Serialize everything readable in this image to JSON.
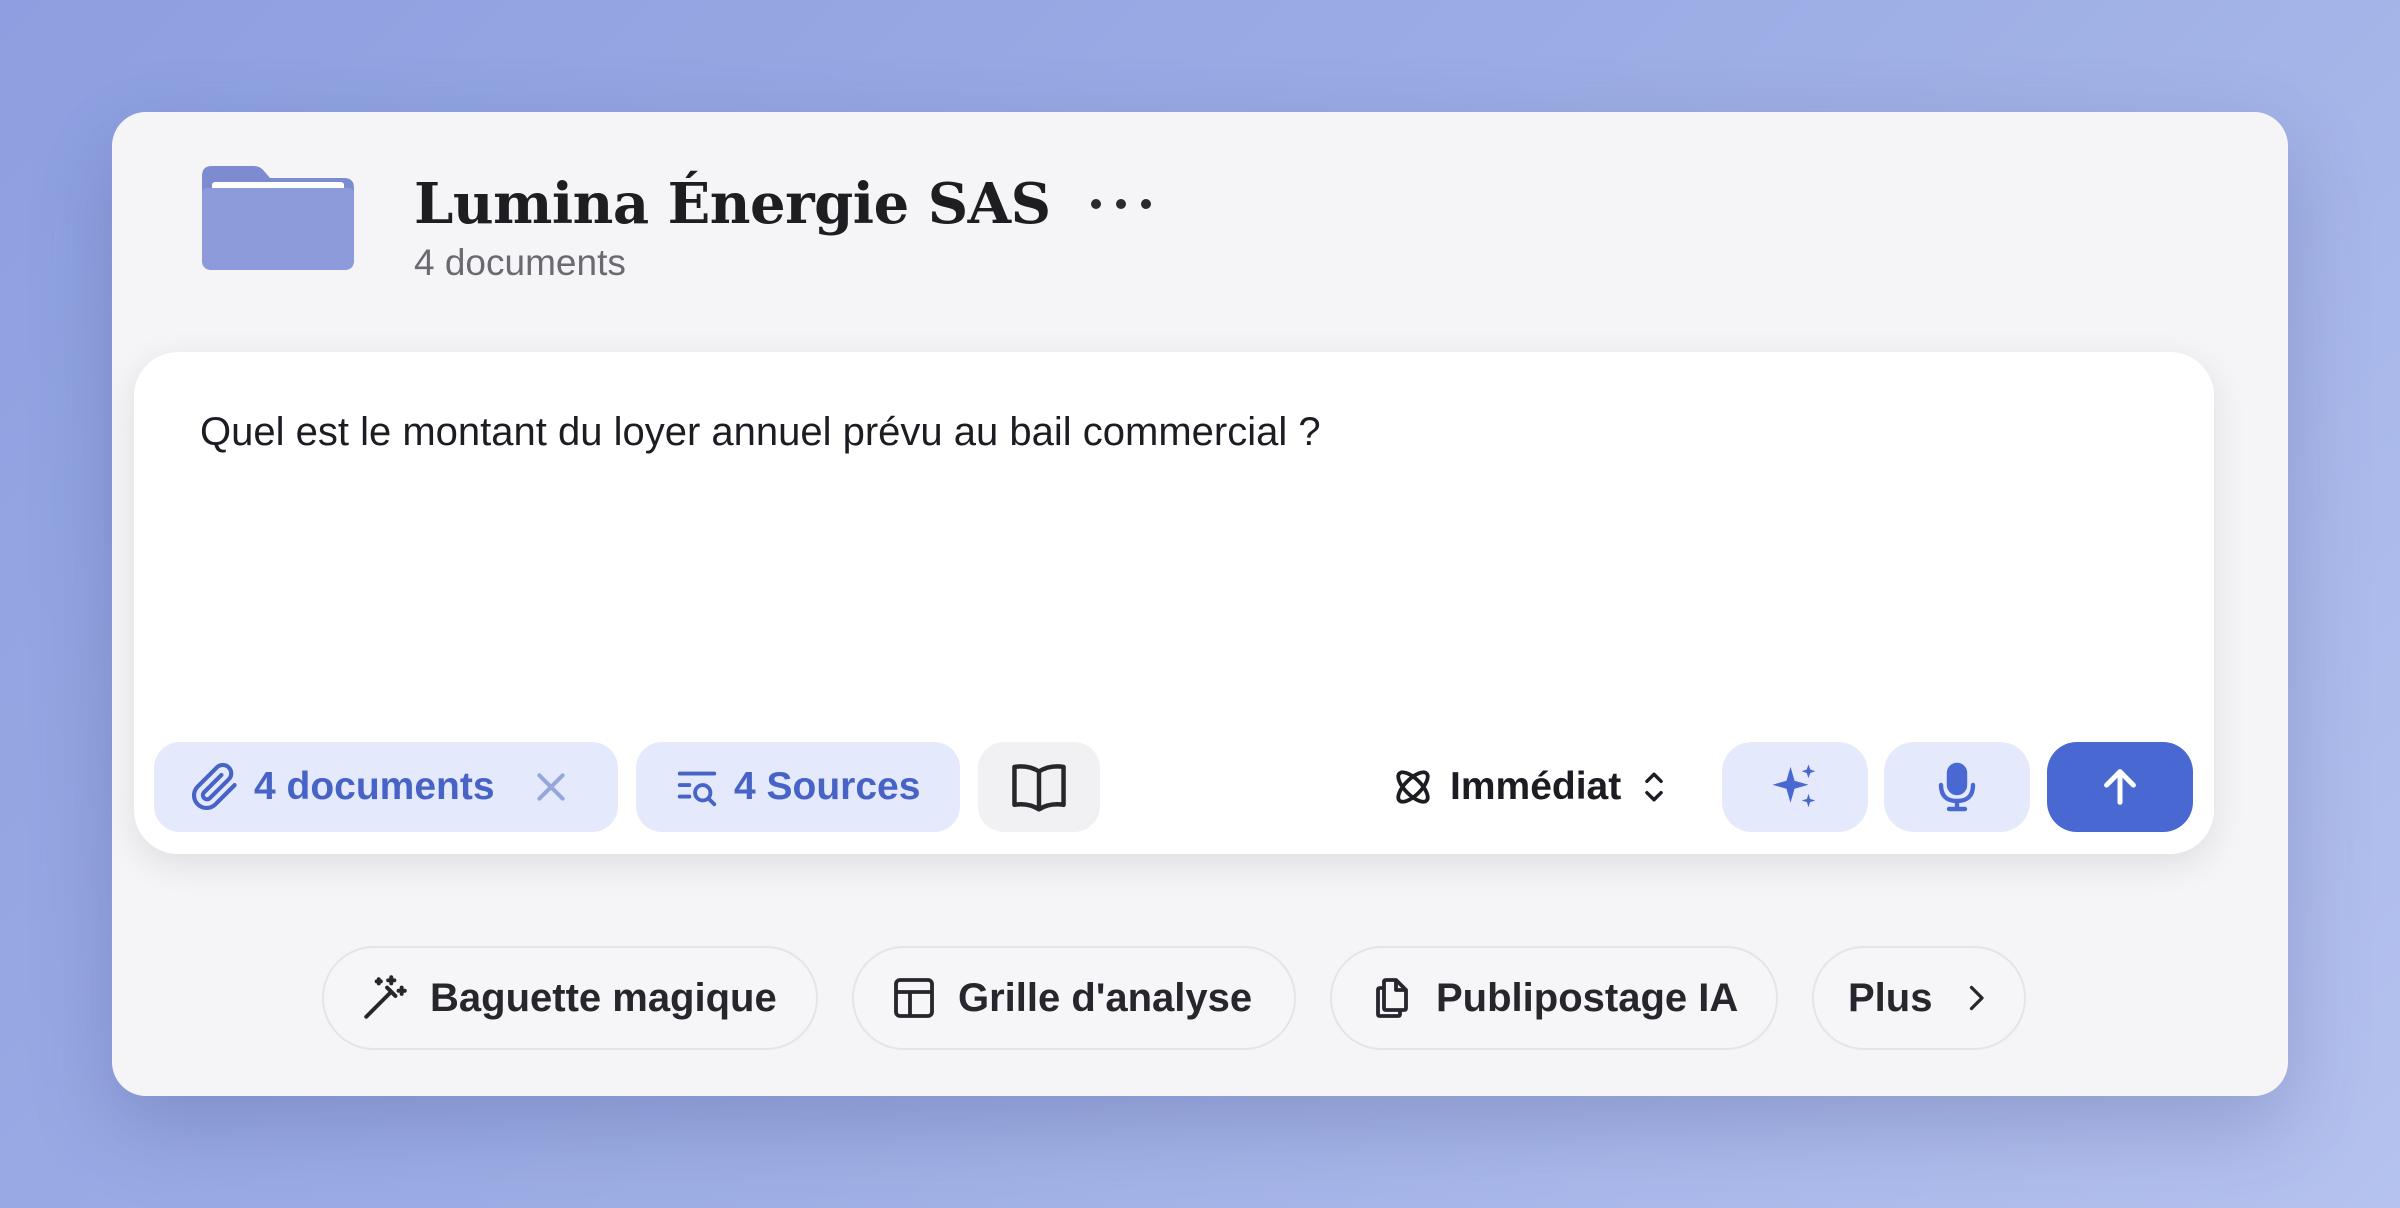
{
  "folder": {
    "title": "Lumina Énergie SAS",
    "subtitle": "4 documents"
  },
  "composer": {
    "prompt": "Quel est le montant du loyer annuel prévu au bail commercial ?",
    "documents_chip": "4 documents",
    "sources_chip": "4 Sources",
    "mode_label": "Immédiat"
  },
  "actions": {
    "magic_wand": "Baguette magique",
    "analysis_grid": "Grille d'analyse",
    "mail_merge": "Publipostage IA",
    "more": "Plus"
  },
  "colors": {
    "accent": "#4a68d2",
    "chip_bg": "#e4e9fb",
    "chip_text": "#4763c6",
    "folder": "#8e9bdb"
  },
  "icons": [
    "folder-icon",
    "more-dots-icon",
    "paperclip-icon",
    "close-icon",
    "search-list-icon",
    "book-icon",
    "atom-icon",
    "chevron-updown-icon",
    "sparkle-icon",
    "microphone-icon",
    "arrow-up-icon",
    "magic-wand-icon",
    "table-icon",
    "copy-icon",
    "chevron-right-icon"
  ]
}
